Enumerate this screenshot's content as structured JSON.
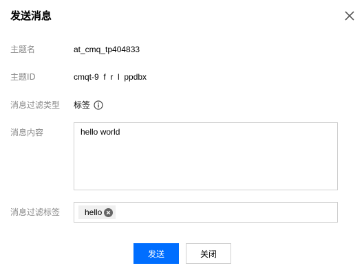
{
  "dialog": {
    "title": "发送消息",
    "close_icon": "close-icon"
  },
  "fields": {
    "topic_name": {
      "label": "主题名",
      "value": "at_cmq_tp404833"
    },
    "topic_id": {
      "label": "主题ID",
      "value": "cmqt-9  f  r  l  ppdbx"
    },
    "filter_type": {
      "label": "消息过滤类型",
      "value": "标签",
      "icon": "info-icon"
    },
    "content": {
      "label": "消息内容",
      "value": "hello world"
    },
    "filter_tags": {
      "label": "消息过滤标签",
      "tags": [
        "hello"
      ],
      "remove_icon": "close-circle-icon"
    }
  },
  "buttons": {
    "send": "发送",
    "close": "关闭"
  },
  "colors": {
    "primary": "#006eff",
    "label": "#888888",
    "border": "#cfcfcf",
    "tag_bg": "#f0f0f0"
  }
}
